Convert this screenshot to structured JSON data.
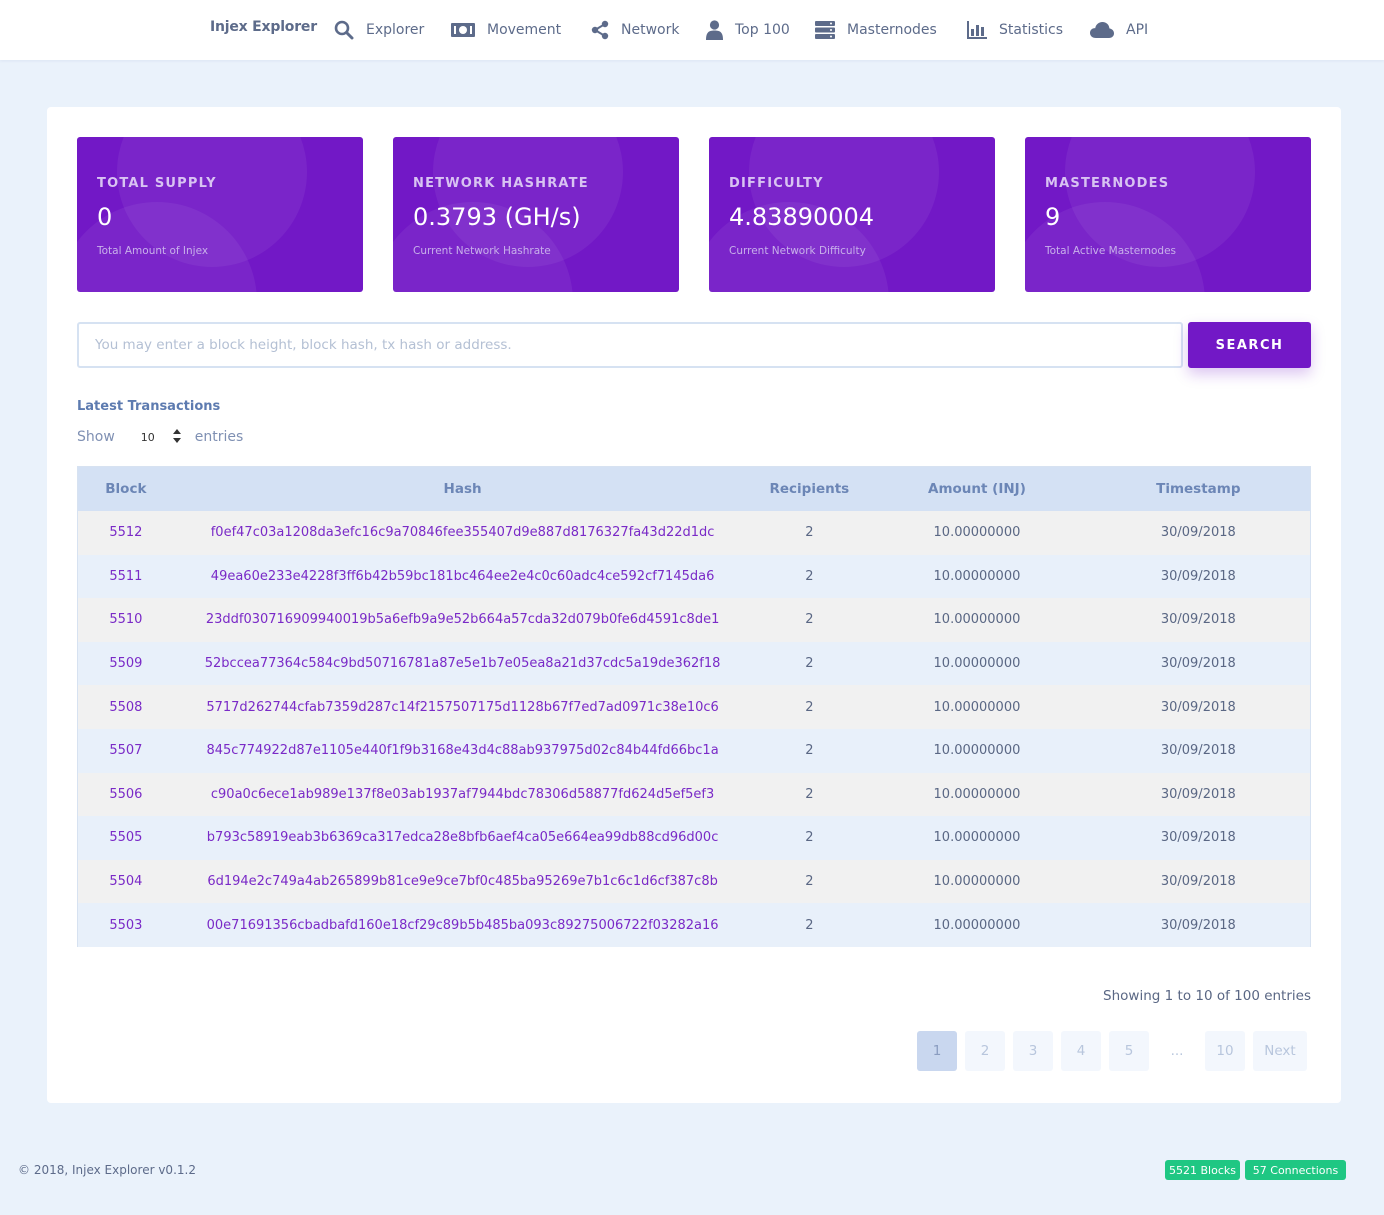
{
  "nav": {
    "brand": "Injex Explorer",
    "items": [
      {
        "label": "Explorer",
        "icon": "search-icon"
      },
      {
        "label": "Movement",
        "icon": "money-icon"
      },
      {
        "label": "Network",
        "icon": "share-icon"
      },
      {
        "label": "Top 100",
        "icon": "user-icon"
      },
      {
        "label": "Masternodes",
        "icon": "server-icon"
      },
      {
        "label": "Statistics",
        "icon": "bar-chart-icon"
      },
      {
        "label": "API",
        "icon": "cloud-icon"
      }
    ]
  },
  "stats": [
    {
      "title": "TOTAL SUPPLY",
      "value": "0",
      "desc": "Total Amount of Injex"
    },
    {
      "title": "NETWORK HASHRATE",
      "value": "0.3793 (GH/s)",
      "desc": "Current Network Hashrate"
    },
    {
      "title": "DIFFICULTY",
      "value": "4.83890004",
      "desc": "Current Network Difficulty"
    },
    {
      "title": "MASTERNODES",
      "value": "9",
      "desc": "Total Active Masternodes"
    }
  ],
  "search": {
    "placeholder": "You may enter a block height, block hash, tx hash or address.",
    "button": "SEARCH"
  },
  "latest": {
    "title": "Latest Transactions",
    "show_label": "Show",
    "entries_value": "10",
    "entries_label": "entries"
  },
  "table": {
    "headers": [
      "Block",
      "Hash",
      "Recipients",
      "Amount (INJ)",
      "Timestamp"
    ],
    "rows": [
      [
        "5512",
        "f0ef47c03a1208da3efc16c9a70846fee355407d9e887d8176327fa43d22d1dc",
        "2",
        "10.00000000",
        "30/09/2018"
      ],
      [
        "5511",
        "49ea60e233e4228f3ff6b42b59bc181bc464ee2e4c0c60adc4ce592cf7145da6",
        "2",
        "10.00000000",
        "30/09/2018"
      ],
      [
        "5510",
        "23ddf030716909940019b5a6efb9a9e52b664a57cda32d079b0fe6d4591c8de1",
        "2",
        "10.00000000",
        "30/09/2018"
      ],
      [
        "5509",
        "52bccea77364c584c9bd50716781a87e5e1b7e05ea8a21d37cdc5a19de362f18",
        "2",
        "10.00000000",
        "30/09/2018"
      ],
      [
        "5508",
        "5717d262744cfab7359d287c14f2157507175d1128b67f7ed7ad0971c38e10c6",
        "2",
        "10.00000000",
        "30/09/2018"
      ],
      [
        "5507",
        "845c774922d87e1105e440f1f9b3168e43d4c88ab937975d02c84b44fd66bc1a",
        "2",
        "10.00000000",
        "30/09/2018"
      ],
      [
        "5506",
        "c90a0c6ece1ab989e137f8e03ab1937af7944bdc78306d58877fd624d5ef5ef3",
        "2",
        "10.00000000",
        "30/09/2018"
      ],
      [
        "5505",
        "b793c58919eab3b6369ca317edca28e8bfb6aef4ca05e664ea99db88cd96d00c",
        "2",
        "10.00000000",
        "30/09/2018"
      ],
      [
        "5504",
        "6d194e2c749a4ab265899b81ce9e9ce7bf0c485ba95269e7b1c6c1d6cf387c8b",
        "2",
        "10.00000000",
        "30/09/2018"
      ],
      [
        "5503",
        "00e71691356cbadbafd160e18cf29c89b5b485ba093c89275006722f03282a16",
        "2",
        "10.00000000",
        "30/09/2018"
      ]
    ]
  },
  "footer": {
    "showing": "Showing 1 to 10 of 100 entries",
    "pages": [
      "1",
      "2",
      "3",
      "4",
      "5",
      "...",
      "10",
      "Next"
    ],
    "copyright": "© 2018, Injex Explorer v0.1.2",
    "blocks_badge": "5521 Blocks",
    "connections_badge": "57 Connections"
  },
  "colors": {
    "accent": "#7218c6",
    "background": "#eaf2fb",
    "badge": "#1fc783",
    "table_header": "#d4e1f4"
  }
}
